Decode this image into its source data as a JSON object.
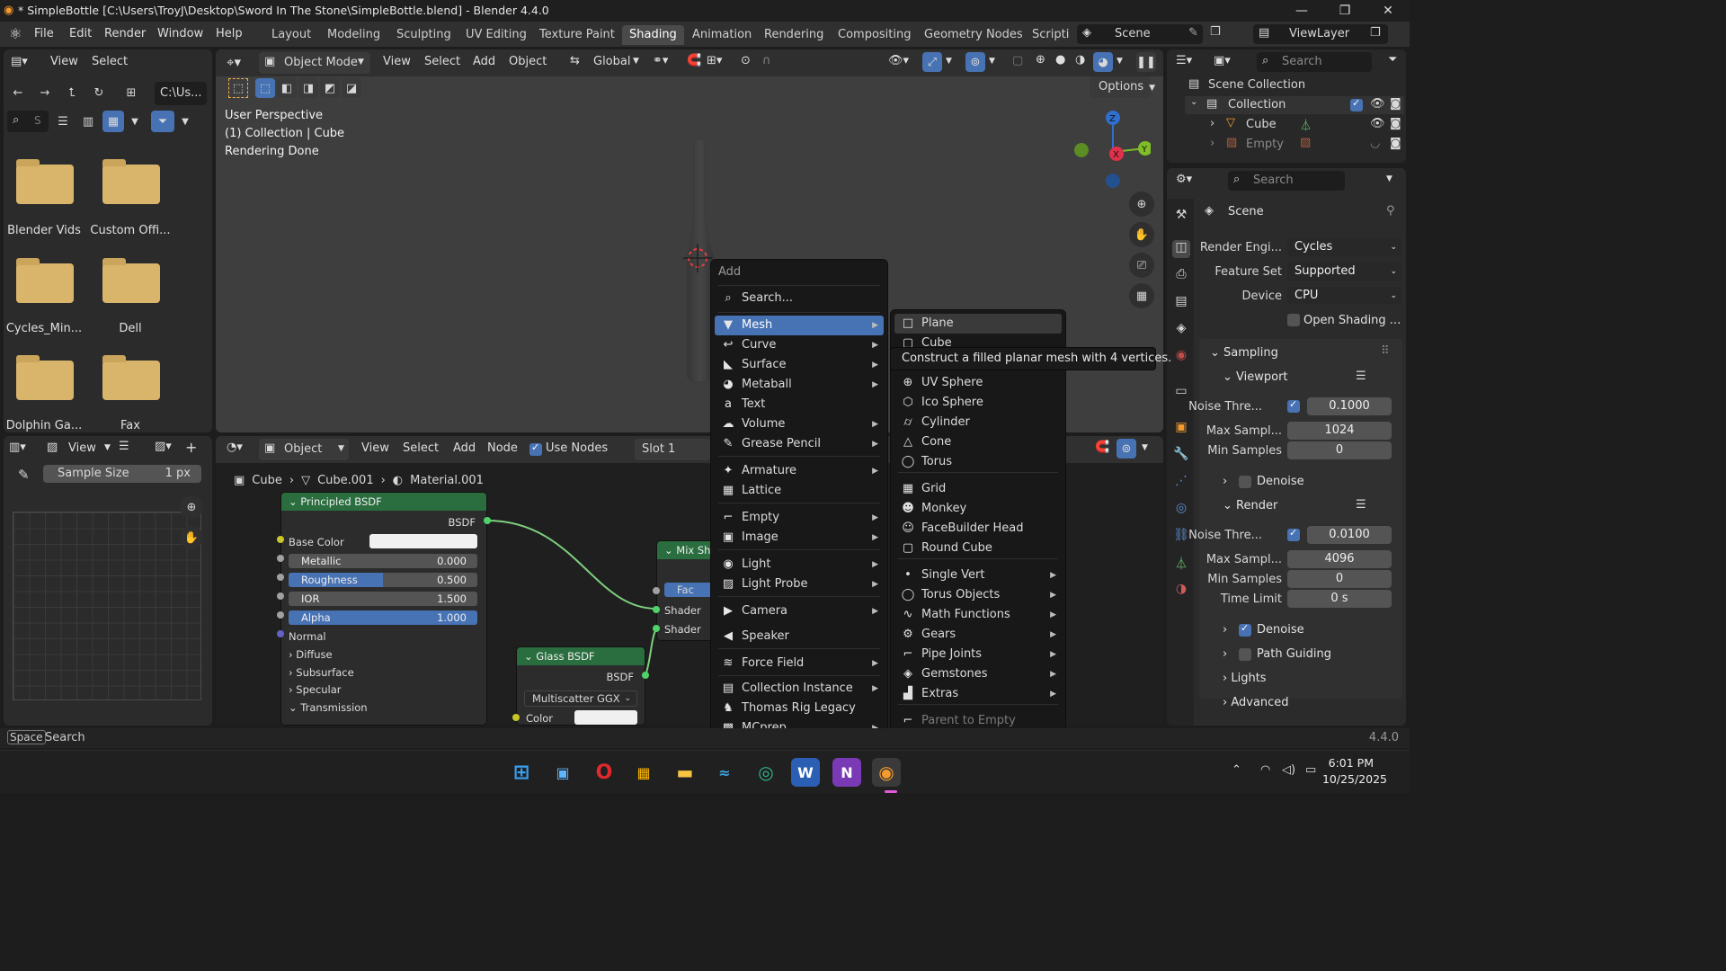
{
  "title_bar": {
    "title": "* SimpleBottle [C:\\Users\\TroyJ\\Desktop\\Sword In The Stone\\SimpleBottle.blend] - Blender 4.4.0"
  },
  "menubar": {
    "menus": [
      "File",
      "Edit",
      "Render",
      "Window",
      "Help"
    ],
    "workspaces": [
      "Layout",
      "Modeling",
      "Sculpting",
      "UV Editing",
      "Texture Paint",
      "Shading",
      "Animation",
      "Rendering",
      "Compositing",
      "Geometry Nodes",
      "Scripti"
    ],
    "active_workspace": "Shading",
    "scene": "Scene",
    "view_layer": "ViewLayer"
  },
  "file_browser": {
    "view_label": "View",
    "select_label": "Select",
    "path": "C:\\Us...",
    "search_placeholder": "S",
    "folders": [
      "Blender Vids",
      "Custom Offi...",
      "Cycles_Min...",
      "Dell",
      "Dolphin Ga...",
      "Fax"
    ]
  },
  "viewport": {
    "mode": "Object Mode",
    "menus": [
      "View",
      "Select",
      "Add",
      "Object"
    ],
    "orientation": "Global",
    "options_label": "Options",
    "info": [
      "User Perspective",
      "(1) Collection | Cube",
      "Rendering Done"
    ],
    "gizmo_axes": [
      "Z",
      "X",
      "Y"
    ]
  },
  "image_editor": {
    "view_label": "View",
    "sample_size_label": "Sample Size",
    "sample_size_value": "1 px"
  },
  "node_editor": {
    "type": "Object",
    "menus": [
      "View",
      "Select",
      "Add",
      "Node"
    ],
    "use_nodes_label": "Use Nodes",
    "slot": "Slot 1",
    "breadcrumb": [
      "Cube",
      "Cube.001",
      "Material.001"
    ],
    "principled": {
      "title": "Principled BSDF",
      "output": "BSDF",
      "base_color_label": "Base Color",
      "fields": [
        {
          "label": "Metallic",
          "value": "0.000",
          "fill": 0
        },
        {
          "label": "Roughness",
          "value": "0.500",
          "fill": 0.5
        },
        {
          "label": "IOR",
          "value": "1.500",
          "fill": 0
        },
        {
          "label": "Alpha",
          "value": "1.000",
          "fill": 1
        }
      ],
      "normal_label": "Normal",
      "panels": [
        "Diffuse",
        "Subsurface",
        "Specular",
        "Transmission"
      ]
    },
    "mix_shader": {
      "title": "Mix Sha",
      "fac": "Fac",
      "shader1": "Shader",
      "shader2": "Shader"
    },
    "glass": {
      "title": "Glass BSDF",
      "output": "BSDF",
      "distribution": "Multiscatter GGX",
      "color_label": "Color"
    }
  },
  "add_menu": {
    "title": "Add",
    "search": "Search...",
    "items": [
      {
        "label": "Mesh",
        "glyph": "▼",
        "submenu": true,
        "active": true
      },
      {
        "label": "Curve",
        "glyph": "↩",
        "submenu": true
      },
      {
        "label": "Surface",
        "glyph": "◣",
        "submenu": true
      },
      {
        "label": "Metaball",
        "glyph": "◕",
        "submenu": true
      },
      {
        "label": "Text",
        "glyph": "a",
        "submenu": false
      },
      {
        "label": "Volume",
        "glyph": "☁",
        "submenu": true
      },
      {
        "label": "Grease Pencil",
        "glyph": "✎",
        "submenu": true
      },
      {
        "label": "Armature",
        "glyph": "✦",
        "submenu": true
      },
      {
        "label": "Lattice",
        "glyph": "▦",
        "submenu": false
      },
      {
        "label": "Empty",
        "glyph": "⌐",
        "submenu": true
      },
      {
        "label": "Image",
        "glyph": "▣",
        "submenu": true
      },
      {
        "label": "Light",
        "glyph": "◉",
        "submenu": true
      },
      {
        "label": "Light Probe",
        "glyph": "▨",
        "submenu": true
      },
      {
        "label": "Camera",
        "glyph": "▶",
        "submenu": true
      },
      {
        "label": "Speaker",
        "glyph": "◀",
        "submenu": false
      },
      {
        "label": "Force Field",
        "glyph": "≋",
        "submenu": true
      },
      {
        "label": "Collection Instance",
        "glyph": "▤",
        "submenu": true
      },
      {
        "label": "Thomas Rig Legacy",
        "glyph": "♞",
        "submenu": false
      },
      {
        "label": "MCprep",
        "glyph": "▩",
        "submenu": true
      }
    ]
  },
  "mesh_menu": {
    "items": [
      {
        "label": "Plane",
        "glyph": "□",
        "submenu": false,
        "hover": true
      },
      {
        "label": "Cube",
        "glyph": "▢",
        "submenu": false
      },
      {
        "label": "UV Sphere",
        "glyph": "⊕",
        "submenu": false
      },
      {
        "label": "Ico Sphere",
        "glyph": "⬡",
        "submenu": false
      },
      {
        "label": "Cylinder",
        "glyph": "⌭",
        "submenu": false
      },
      {
        "label": "Cone",
        "glyph": "△",
        "submenu": false
      },
      {
        "label": "Torus",
        "glyph": "◯",
        "submenu": false
      },
      {
        "label": "Grid",
        "glyph": "▦",
        "submenu": false
      },
      {
        "label": "Monkey",
        "glyph": "☻",
        "submenu": false
      },
      {
        "label": "FaceBuilder Head",
        "glyph": "☺",
        "submenu": false
      },
      {
        "label": "Round Cube",
        "glyph": "▢",
        "submenu": false
      },
      {
        "label": "Single Vert",
        "glyph": "•",
        "submenu": true
      },
      {
        "label": "Torus Objects",
        "glyph": "◯",
        "submenu": true
      },
      {
        "label": "Math Functions",
        "glyph": "∿",
        "submenu": true
      },
      {
        "label": "Gears",
        "glyph": "⚙",
        "submenu": true
      },
      {
        "label": "Pipe Joints",
        "glyph": "⌐",
        "submenu": true
      },
      {
        "label": "Gemstones",
        "glyph": "◈",
        "submenu": true
      },
      {
        "label": "Extras",
        "glyph": "▟",
        "submenu": true
      },
      {
        "label": "Parent to Empty",
        "glyph": "⌐",
        "submenu": false,
        "disabled": true
      }
    ],
    "tooltip": "Construct a filled planar mesh with 4 vertices."
  },
  "outliner": {
    "search_placeholder": "Search",
    "root": "Scene Collection",
    "collection": "Collection",
    "objects": [
      "Cube",
      "Empty"
    ]
  },
  "properties": {
    "search_placeholder": "Search",
    "context": "Scene",
    "render_engine_label": "Render Engi...",
    "render_engine": "Cycles",
    "feature_set_label": "Feature Set",
    "feature_set": "Supported",
    "device_label": "Device",
    "device": "CPU",
    "open_shading_label": "Open Shading ...",
    "sampling_label": "Sampling",
    "viewport_label": "Viewport",
    "vp_noise_label": "Noise Thre...",
    "vp_noise": "0.1000",
    "vp_max_label": "Max Sampl...",
    "vp_max": "1024",
    "vp_min_label": "Min Samples",
    "vp_min": "0",
    "vp_denoise_label": "Denoise",
    "render_label": "Render",
    "r_noise_label": "Noise Thre...",
    "r_noise": "0.0100",
    "r_max_label": "Max Sampl...",
    "r_max": "4096",
    "r_min_label": "Min Samples",
    "r_min": "0",
    "r_time_label": "Time Limit",
    "r_time": "0 s",
    "denoise_label": "Denoise",
    "path_guiding_label": "Path Guiding",
    "lights_label": "Lights",
    "advanced_label": "Advanced"
  },
  "status_bar": {
    "key": "Space",
    "action": "Search",
    "version": "4.4.0"
  },
  "taskbar": {
    "time": "6:01 PM",
    "date": "10/25/2025"
  },
  "colors": {
    "accent": "#4772b3",
    "node_header_green": "#2a6e3f",
    "folder": "#d8b56a"
  }
}
